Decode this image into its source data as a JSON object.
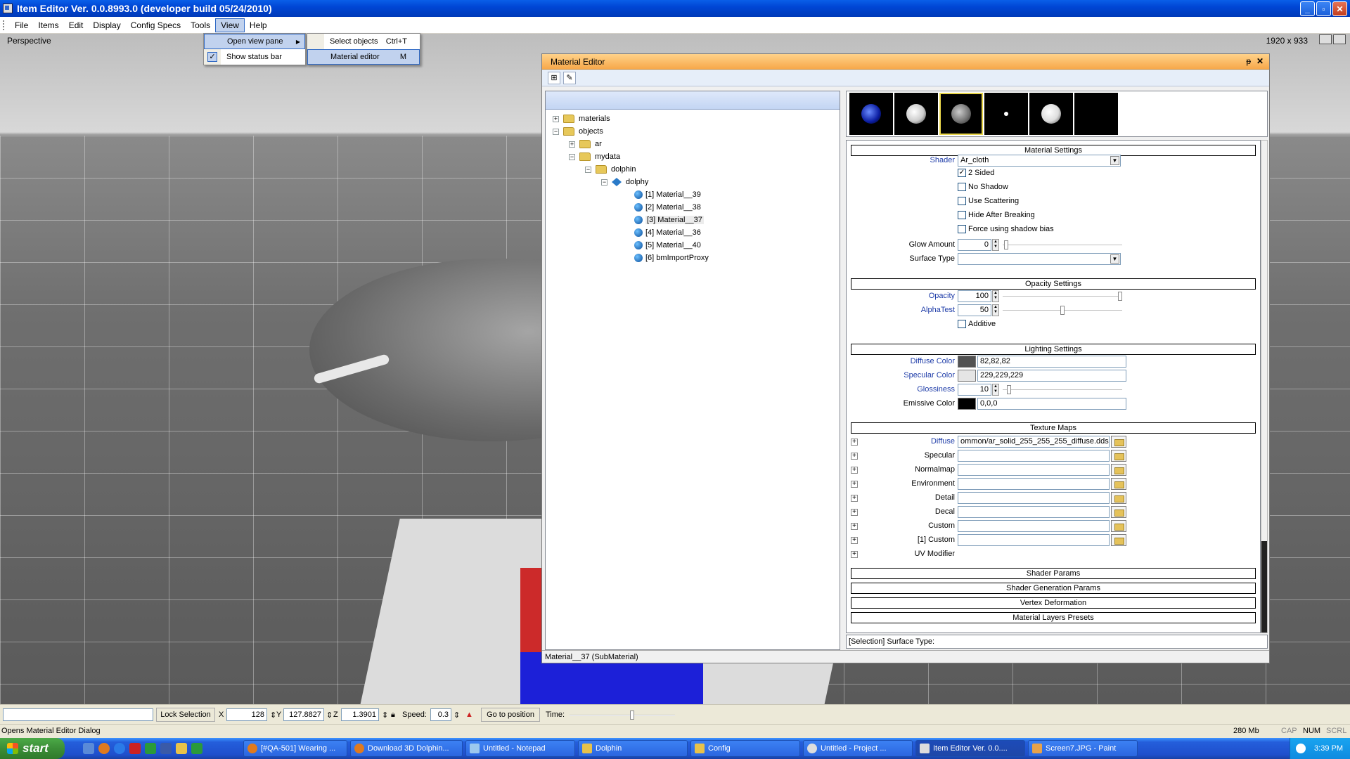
{
  "window": {
    "title": "Item Editor Ver. 0.0.8993.0 (developer build 05/24/2010)"
  },
  "menu": {
    "items": [
      "File",
      "Items",
      "Edit",
      "Display",
      "Config Specs",
      "Tools",
      "View",
      "Help"
    ]
  },
  "viewport": {
    "label": "Perspective",
    "size": "1920 x 933"
  },
  "view_menu": {
    "items": [
      {
        "label": "Open view pane"
      },
      {
        "label": "Show status bar"
      }
    ],
    "submenu": [
      {
        "label": "Select objects",
        "shortcut": "Ctrl+T"
      },
      {
        "label": "Material editor",
        "shortcut": "M"
      }
    ]
  },
  "material_editor": {
    "title": "Material Editor",
    "pin": "ᵽ",
    "close": "✕",
    "toolbar": [
      "⊞",
      "✎"
    ],
    "tree": {
      "nodes": [
        {
          "label": "materials",
          "type": "folder",
          "exp": "+"
        },
        {
          "label": "objects",
          "type": "folder",
          "exp": "−"
        },
        {
          "label": "ar",
          "type": "folder",
          "exp": "+"
        },
        {
          "label": "mydata",
          "type": "folder",
          "exp": "−"
        },
        {
          "label": "dolphin",
          "type": "folder",
          "exp": "−"
        },
        {
          "label": "dolphy",
          "type": "object",
          "exp": "−"
        },
        {
          "label": "[1] Material__39",
          "type": "material"
        },
        {
          "label": "[2] Material__38",
          "type": "material"
        },
        {
          "label": "[3] Material__37",
          "type": "material"
        },
        {
          "label": "[4] Material__36",
          "type": "material"
        },
        {
          "label": "[5] Material__40",
          "type": "material"
        },
        {
          "label": "[6] bmImportProxy",
          "type": "material"
        }
      ]
    },
    "sections": {
      "material": "Material Settings",
      "opacity": "Opacity Settings",
      "lighting": "Lighting Settings",
      "texture": "Texture Maps",
      "shader_params": "Shader Params",
      "shader_gen": "Shader Generation Params",
      "vertex": "Vertex Deformation",
      "layers": "Material Layers Presets"
    },
    "material_settings": {
      "shader_label": "Shader",
      "shader_value": "Ar_cloth",
      "checkboxes": [
        {
          "label": "2 Sided",
          "checked": true
        },
        {
          "label": "No Shadow",
          "checked": false
        },
        {
          "label": "Use Scattering",
          "checked": false
        },
        {
          "label": "Hide After Breaking",
          "checked": false
        },
        {
          "label": "Force using shadow bias",
          "checked": false
        }
      ],
      "glow_label": "Glow Amount",
      "glow_value": "0",
      "surface_label": "Surface Type",
      "surface_value": ""
    },
    "opacity_settings": {
      "opacity_label": "Opacity",
      "opacity_value": "100",
      "alphatest_label": "AlphaTest",
      "alphatest_value": "50",
      "additive_label": "Additive"
    },
    "lighting_settings": {
      "diffuse_label": "Diffuse Color",
      "diffuse_value": "82,82,82",
      "diffuse_hex": "#525252",
      "specular_label": "Specular Color",
      "specular_value": "229,229,229",
      "specular_hex": "#e5e5e5",
      "gloss_label": "Glossiness",
      "gloss_value": "10",
      "emissive_label": "Emissive Color",
      "emissive_value": "0,0,0",
      "emissive_hex": "#000000"
    },
    "texture_maps": [
      {
        "label": "Diffuse",
        "value": "ommon/ar_solid_255_255_255_diffuse.dds",
        "blue": true
      },
      {
        "label": "Specular",
        "value": ""
      },
      {
        "label": "Normalmap",
        "value": ""
      },
      {
        "label": "Environment",
        "value": ""
      },
      {
        "label": "Detail",
        "value": ""
      },
      {
        "label": "Decal",
        "value": ""
      },
      {
        "label": "Custom",
        "value": ""
      },
      {
        "label": "[1] Custom",
        "value": ""
      },
      {
        "label": "UV Modifier",
        "value": null
      }
    ],
    "property_status": "[Selection] Surface Type:",
    "status": "Material__37 (SubMaterial)"
  },
  "bottombar": {
    "lock_selection": "Lock Selection",
    "x_label": "X",
    "x_value": "128",
    "y_label": "Y",
    "y_value": "127.8827",
    "z_label": "Z",
    "z_value": "1.3901",
    "speed_label": "Speed:",
    "speed_value": "0.3",
    "goto": "Go to position",
    "time_label": "Time:"
  },
  "statusbar": {
    "message": "Opens Material Editor Dialog",
    "memory": "280 Mb",
    "cap": "CAP",
    "num": "NUM",
    "scrl": "SCRL"
  },
  "taskbar": {
    "start": "start",
    "tasks": [
      "[#QA-501] Wearing ...",
      "Download 3D Dolphin...",
      "Untitled - Notepad",
      "Dolphin",
      "Config",
      "Untitled      - Project ...",
      "Item Editor Ver. 0.0....",
      "Screen7.JPG - Paint"
    ],
    "clock": "3:39 PM"
  }
}
